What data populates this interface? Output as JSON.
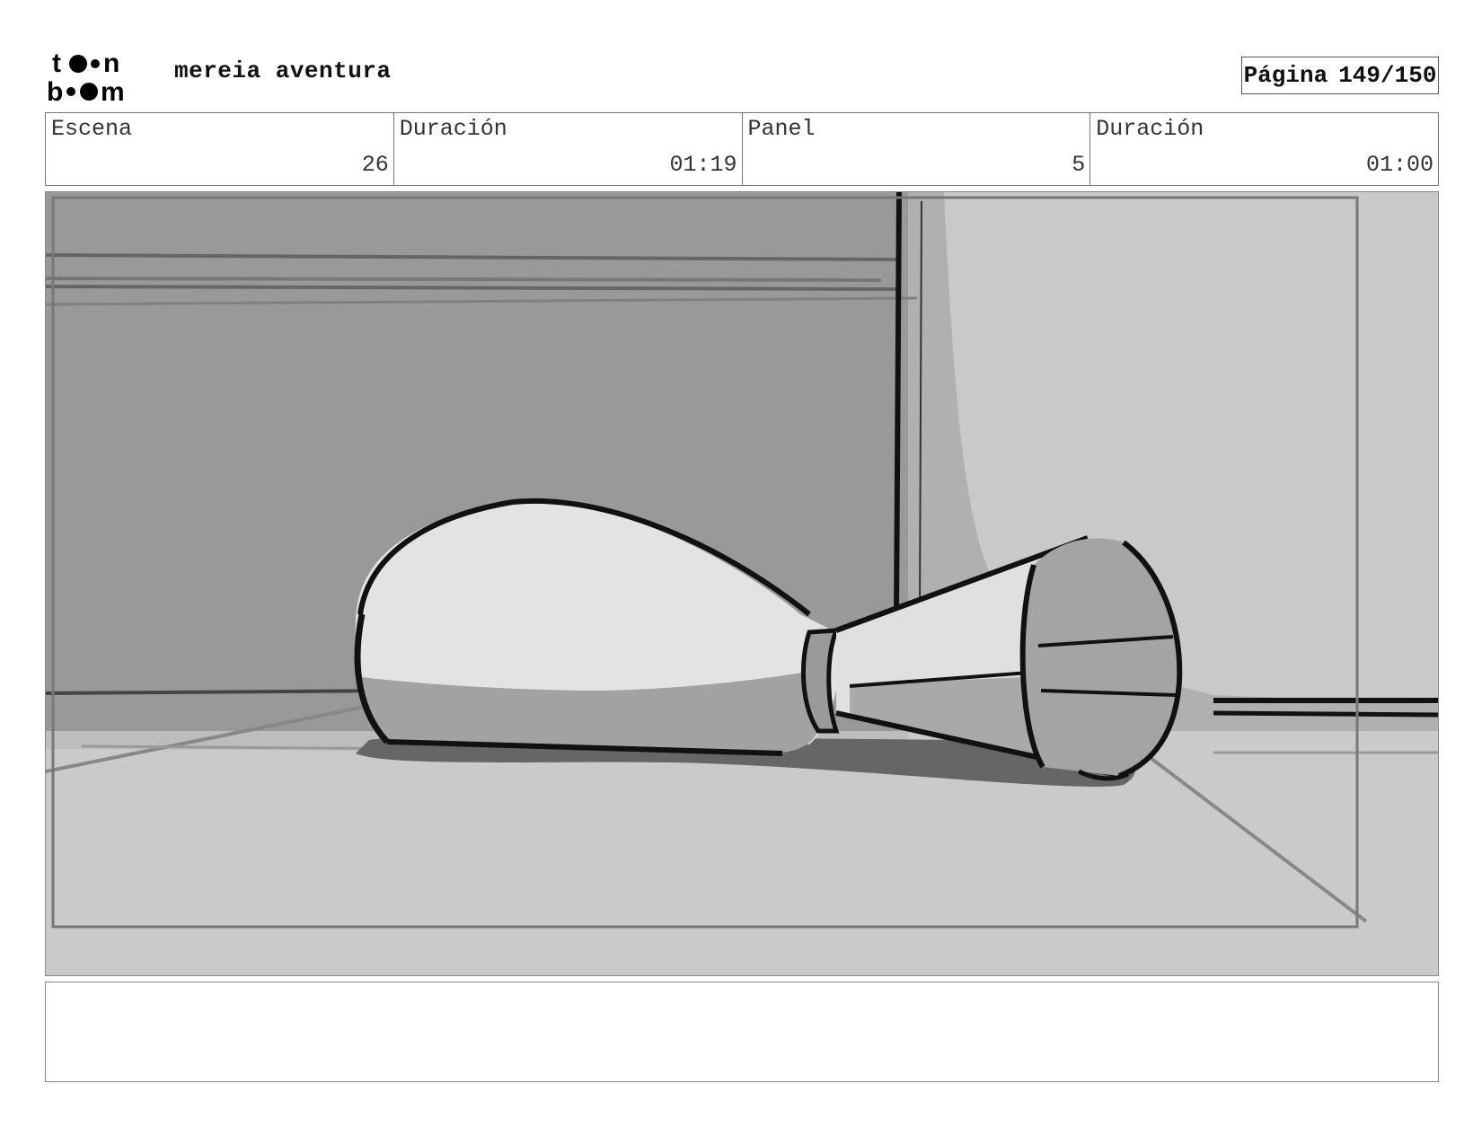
{
  "header": {
    "project_title": "mereia aventura",
    "page_label": "Página",
    "page_number": "149/150"
  },
  "info": {
    "scene_label": "Escena",
    "scene_value": "26",
    "scene_duration_label": "Duración",
    "scene_duration_value": "01:19",
    "panel_label": "Panel",
    "panel_value": "5",
    "panel_duration_label": "Duración",
    "panel_duration_value": "01:00"
  },
  "notes": {
    "text": ""
  }
}
